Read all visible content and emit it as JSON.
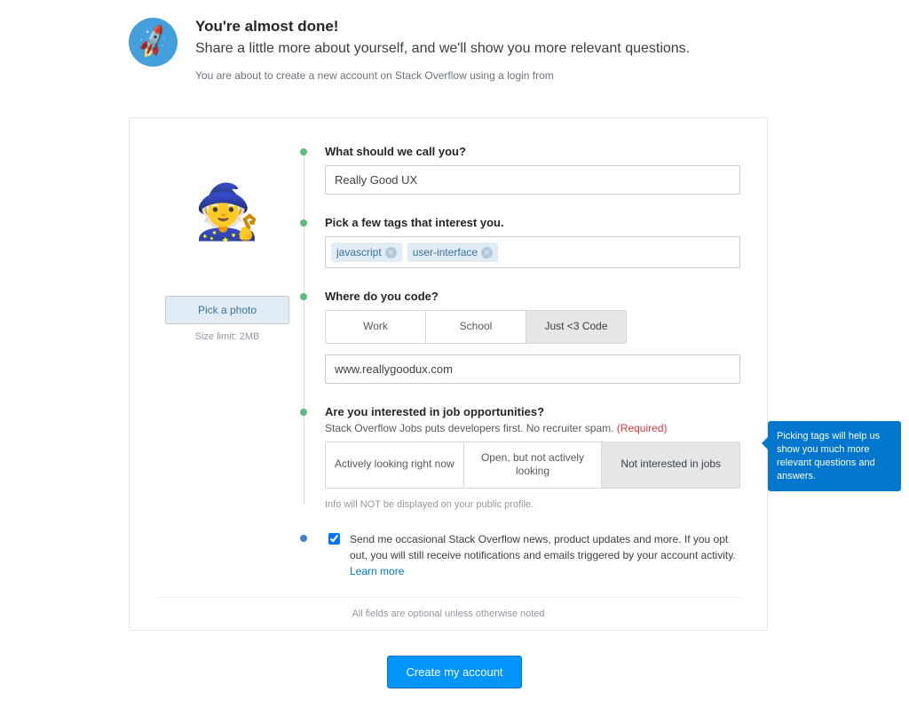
{
  "intro": {
    "heading": "You're almost done!",
    "subheading": "Share a little more about yourself, and we'll show you more relevant questions.",
    "note": "You are about to create a new account on Stack Overflow using a login from"
  },
  "photo": {
    "button": "Pick a photo",
    "size_limit": "Size limit: 2MB"
  },
  "name": {
    "label": "What should we call you?",
    "value": "Really Good UX"
  },
  "tags": {
    "label": "Pick a few tags that interest you.",
    "items": [
      "javascript",
      "user-interface"
    ]
  },
  "where": {
    "label": "Where do you code?",
    "options": [
      "Work",
      "School",
      "Just <3 Code"
    ],
    "selected": 2
  },
  "website": {
    "value": "www.reallygoodux.com"
  },
  "jobs": {
    "label": "Are you interested in job opportunities?",
    "sub": "Stack Overflow Jobs puts developers first. No recruiter spam.",
    "required": "(Required)",
    "options": [
      "Actively looking right now",
      "Open, but not actively looking",
      "Not interested in jobs"
    ],
    "selected": 2,
    "fine": "Info will NOT be displayed on your public profile."
  },
  "consent": {
    "text": "Send me occasional Stack Overflow news, product updates and more. If you opt out, you will still receive notifications and emails triggered by your account activity. ",
    "link": "Learn more",
    "checked": true
  },
  "footer": "All fields are optional unless otherwise noted",
  "tooltip": "Picking tags will help us show you much more relevant questions and answers.",
  "submit": "Create my account"
}
